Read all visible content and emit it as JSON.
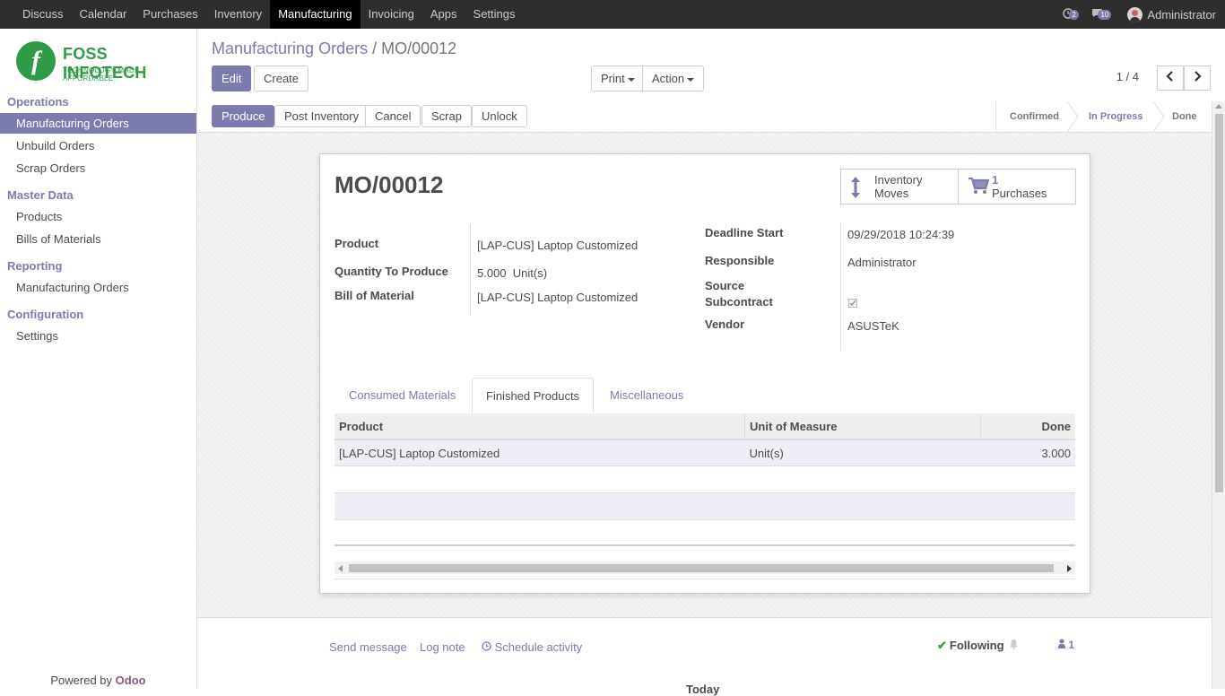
{
  "topbar": {
    "menu": [
      "Discuss",
      "Calendar",
      "Purchases",
      "Inventory",
      "Manufacturing",
      "Invoicing",
      "Apps",
      "Settings"
    ],
    "activity_count": "2",
    "message_count": "10",
    "username": "Administrator"
  },
  "logo": {
    "name": "FOSS INFOTECH",
    "tagline": "TECHNOLOGY MADE AFFORDABLE"
  },
  "sidebar": {
    "sections": [
      {
        "title": "Operations",
        "items": [
          "Manufacturing Orders",
          "Unbuild Orders",
          "Scrap Orders"
        ]
      },
      {
        "title": "Master Data",
        "items": [
          "Products",
          "Bills of Materials"
        ]
      },
      {
        "title": "Reporting",
        "items": [
          "Manufacturing Orders"
        ]
      },
      {
        "title": "Configuration",
        "items": [
          "Settings"
        ]
      }
    ],
    "powered_by": "Powered by",
    "powered_brand": "Odoo"
  },
  "breadcrumb": {
    "parent": "Manufacturing Orders",
    "separator": "/",
    "current": "MO/00012"
  },
  "buttons": {
    "edit": "Edit",
    "create": "Create",
    "print": "Print",
    "action": "Action",
    "produce": "Produce",
    "post_inventory": "Post Inventory",
    "cancel": "Cancel",
    "scrap": "Scrap",
    "unlock": "Unlock"
  },
  "pager": {
    "text": "1 / 4"
  },
  "statusbar": {
    "steps": [
      "Confirmed",
      "In Progress",
      "Done"
    ],
    "active": "In Progress"
  },
  "form": {
    "title": "MO/00012",
    "smart_buttons": {
      "moves_line1": "Inventory",
      "moves_line2": "Moves",
      "purchases_count": "1",
      "purchases_label": "Purchases"
    },
    "left": {
      "product_label": "Product",
      "product": "[LAP-CUS] Laptop Customized",
      "qty_label": "Quantity To Produce",
      "qty": "5.000",
      "uom": "Unit(s)",
      "bom_label": "Bill of Material",
      "bom": "[LAP-CUS] Laptop Customized"
    },
    "right": {
      "deadline_label": "Deadline Start",
      "deadline": "09/29/2018 10:24:39",
      "responsible_label": "Responsible",
      "responsible": "Administrator",
      "subcontract_label_1": "Source",
      "subcontract_label_2": "Subcontract",
      "subcontract_checked": true,
      "vendor_label": "Vendor",
      "vendor": "ASUSTeK"
    },
    "tabs": [
      "Consumed Materials",
      "Finished Products",
      "Miscellaneous"
    ],
    "active_tab": "Finished Products",
    "table": {
      "headers": [
        "Product",
        "Unit of Measure",
        "Done"
      ],
      "rows": [
        [
          "[LAP-CUS] Laptop Customized",
          "Unit(s)",
          "3.000"
        ]
      ]
    }
  },
  "chatter": {
    "send_message": "Send message",
    "log_note": "Log note",
    "schedule_activity": "Schedule activity",
    "following": "Following",
    "followers_count": "1",
    "today": "Today"
  },
  "colors": {
    "accent": "#7c7bad",
    "topbar": "#2e2e2e",
    "brand_green": "#2f9b47"
  }
}
